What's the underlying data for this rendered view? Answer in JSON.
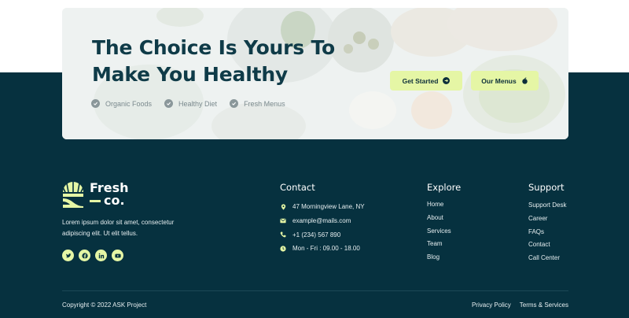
{
  "cta": {
    "title_line1": "The Choice Is Yours To",
    "title_line2": "Make You Healthy",
    "features": [
      "Organic Foods",
      "Healthy Diet",
      "Fresh Menus"
    ],
    "buttons": {
      "get_started": "Get Started",
      "our_menus": "Our Menus"
    }
  },
  "footer": {
    "brand": {
      "line1": "Fresh",
      "line2": "co."
    },
    "about": "Lorem ipsum dolor sit amet, consectetur adipiscing elit. Ut elit tellus.",
    "socials": [
      "twitter-icon",
      "facebook-icon",
      "linkedin-icon",
      "youtube-icon"
    ],
    "contact": {
      "title": "Contact",
      "items": [
        {
          "icon": "location-pin-icon",
          "text": "47 Morningview Lane, NY"
        },
        {
          "icon": "mail-icon",
          "text": "example@mails.com"
        },
        {
          "icon": "phone-icon",
          "text": "+1 (234) 567 890"
        },
        {
          "icon": "clock-icon",
          "text": "Mon - Fri : 09.00 - 18.00"
        }
      ]
    },
    "explore": {
      "title": "Explore",
      "links": [
        "Home",
        "About",
        "Services",
        "Team",
        "Blog"
      ]
    },
    "support": {
      "title": "Support",
      "links": [
        "Support Desk",
        "Career",
        "FAQs",
        "Contact",
        "Call Center"
      ]
    },
    "copyright": "Copyright © 2022 ASK Project",
    "legal": [
      "Privacy Policy",
      "Terms & Services"
    ]
  },
  "colors": {
    "dark": "#06313f",
    "accent": "#e5f6a5",
    "title": "#0f3b48"
  }
}
